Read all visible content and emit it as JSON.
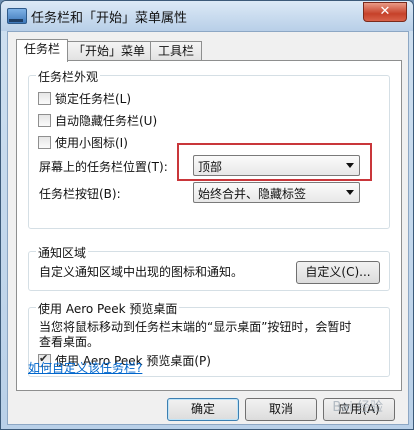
{
  "window": {
    "title": "任务栏和「开始」菜单属性",
    "close_glyph": "✕"
  },
  "tabs": [
    {
      "label": "任务栏",
      "active": true
    },
    {
      "label": "「开始」菜单",
      "active": false
    },
    {
      "label": "工具栏",
      "active": false
    }
  ],
  "appearance": {
    "title": "任务栏外观",
    "lock_label": "锁定任务栏(L)",
    "lock_checked": false,
    "autohide_label": "自动隐藏任务栏(U)",
    "autohide_checked": false,
    "small_icons_label": "使用小图标(I)",
    "small_icons_checked": false,
    "location_label": "屏幕上的任务栏位置(T):",
    "location_value": "顶部",
    "buttons_label": "任务栏按钮(B):",
    "buttons_value": "始终合并、隐藏标签"
  },
  "notification": {
    "title": "通知区域",
    "description": "自定义通知区域中出现的图标和通知。",
    "customize_button": "自定义(C)..."
  },
  "aero_peek": {
    "title": "使用 Aero Peek 预览桌面",
    "description_line1": "当您将鼠标移动到任务栏末端的“显示桌面”按钮时，会暂时",
    "description_line2": "查看桌面。",
    "checkbox_label": "使用 Aero Peek 预览桌面(P)",
    "checkbox_checked": true
  },
  "help_link": "如何自定义该任务栏?",
  "footer": {
    "ok": "确定",
    "cancel": "取消",
    "apply": "应用(A)"
  },
  "watermark": "Bai 经验"
}
